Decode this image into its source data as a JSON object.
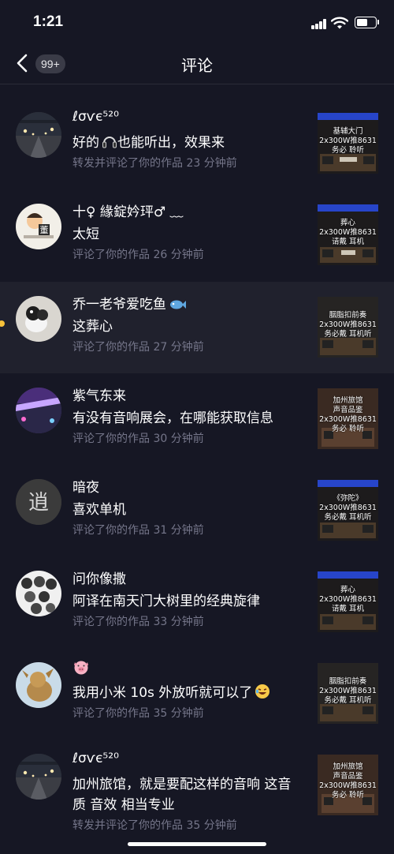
{
  "status": {
    "time": "1:21"
  },
  "nav": {
    "badge": "99+",
    "title": "评论"
  },
  "comments": [
    {
      "user": "ℓσѵє⁵²⁰",
      "text_before": "好的",
      "text_after": "也能听出，效果来",
      "meta": "转发并评论了你的作品  23 分钟前",
      "thumb_lines": [
        "基辅大门",
        "2x300W推8631",
        "务必   聆听"
      ]
    },
    {
      "user": "十♀ 緣錠妗玶♂ ﹏",
      "text": "太短",
      "meta": "评论了你的作品  26 分钟前",
      "thumb_lines": [
        "葬心",
        "2x300W推8631",
        "请戴   耳机"
      ]
    },
    {
      "user": "乔一老爷爱吃鱼",
      "text": "这葬心",
      "meta": "评论了你的作品  27 分钟前",
      "thumb_lines": [
        "胭脂扣前奏",
        "2x300W推8631",
        "务必戴  耳机听"
      ]
    },
    {
      "user": "紫气东来",
      "text": "有没有音响展会，在哪能获取信息",
      "meta": "评论了你的作品  30 分钟前",
      "thumb_lines": [
        "加州旅馆",
        "声音品鉴",
        "2x300W推8631",
        "务必   聆听"
      ]
    },
    {
      "user": "暗夜",
      "text": "喜欢单机",
      "meta": "评论了你的作品  31 分钟前",
      "thumb_lines": [
        "《弥陀》",
        "2x300W推8631",
        "务必戴  耳机听"
      ]
    },
    {
      "user": "问你像撒",
      "text": "阿译在南天门大树里的经典旋律",
      "meta": "评论了你的作品  33 分钟前",
      "thumb_lines": [
        "葬心",
        "2x300W推8631",
        "请戴   耳机"
      ]
    },
    {
      "user": "",
      "text": "我用小米 10s 外放听就可以了",
      "meta": "评论了你的作品  35 分钟前",
      "thumb_lines": [
        "胭脂扣前奏",
        "2x300W推8631",
        "务必戴  耳机听"
      ]
    },
    {
      "user": "ℓσѵє⁵²⁰",
      "text": "加州旅馆，就是要配这样的音响 这音质 音效 相当专业",
      "meta": "转发并评论了你的作品  35 分钟前",
      "thumb_lines": [
        "加州旅馆",
        "声音品鉴",
        "2x300W推8631",
        "务必   聆听"
      ]
    }
  ],
  "icons": {
    "back": "chevron-left-icon",
    "headphones": "headphones-emoji",
    "fish": "fish-emoji",
    "pig": "pig-emoji",
    "laugh": "laughing-emoji"
  },
  "colors": {
    "background": "#161724",
    "highlight": "#20212d",
    "meta": "#75768a",
    "unread_dot": "#f8c23a"
  }
}
